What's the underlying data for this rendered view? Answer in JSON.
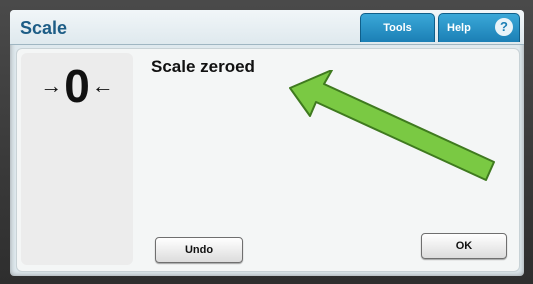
{
  "window": {
    "title": "Scale"
  },
  "tabs": [
    {
      "label": "Tools"
    },
    {
      "label": "Help"
    }
  ],
  "scale": {
    "left_arrow": "→",
    "value": "0",
    "right_arrow": "←"
  },
  "status": {
    "message": "Scale zeroed"
  },
  "buttons": {
    "undo_label": "Undo",
    "ok_label": "OK"
  },
  "icons": {
    "help": "question-circle-icon",
    "annotation": "green-arrow-icon"
  },
  "colors": {
    "title": "#1d5d86",
    "tab": "#1b7fb5",
    "annotation_arrow": "#7ac943"
  }
}
